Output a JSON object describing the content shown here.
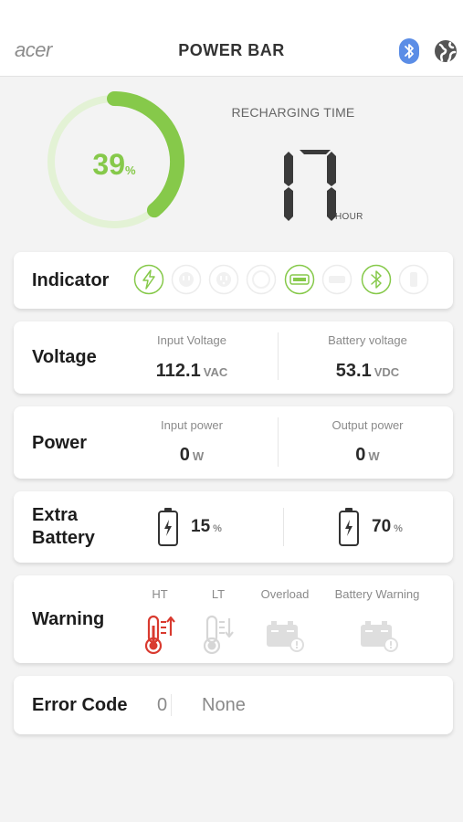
{
  "header": {
    "logo": "acer",
    "title": "POWER BAR",
    "icons": [
      "bluetooth-icon",
      "globe-icon"
    ],
    "accent": "#5b8de6"
  },
  "battery": {
    "percent_value": 39,
    "percent_text": "39",
    "percent_unit": "%",
    "color": "#86c94a"
  },
  "recharge": {
    "label": "RECHARGING TIME",
    "value": "17",
    "unit": "HOUR"
  },
  "indicator": {
    "label": "Indicator",
    "icons": [
      {
        "name": "lightning-icon",
        "active": true
      },
      {
        "name": "ac-outlet-icon",
        "active": false
      },
      {
        "name": "ac-outlet-icon-2",
        "active": false
      },
      {
        "name": "usb-c-icon",
        "active": false
      },
      {
        "name": "usb-a-icon",
        "active": true
      },
      {
        "name": "dc-icon",
        "active": false
      },
      {
        "name": "bluetooth-indicator-icon",
        "active": true
      },
      {
        "name": "battery-indicator-icon",
        "active": false
      }
    ]
  },
  "voltage": {
    "label": "Voltage",
    "input_label": "Input Voltage",
    "input_value": "112.1",
    "input_unit": "VAC",
    "battery_label": "Battery voltage",
    "battery_value": "53.1",
    "battery_unit": "VDC"
  },
  "power": {
    "label": "Power",
    "input_label": "Input power",
    "input_value": "0",
    "input_unit": "W",
    "output_label": "Output power",
    "output_value": "0",
    "output_unit": "W"
  },
  "extra_battery": {
    "label_line1": "Extra",
    "label_line2": "Battery",
    "battery1_value": "15",
    "battery1_unit": "%",
    "battery2_value": "70",
    "battery2_unit": "%"
  },
  "warning": {
    "label": "Warning",
    "items": [
      {
        "label": "HT",
        "active": true
      },
      {
        "label": "LT",
        "active": false
      },
      {
        "label": "Overload",
        "active": false
      },
      {
        "label": "Battery Warning",
        "active": false
      }
    ],
    "active_color": "#d93a2f"
  },
  "error": {
    "label": "Error Code",
    "code": "0",
    "text": "None"
  }
}
